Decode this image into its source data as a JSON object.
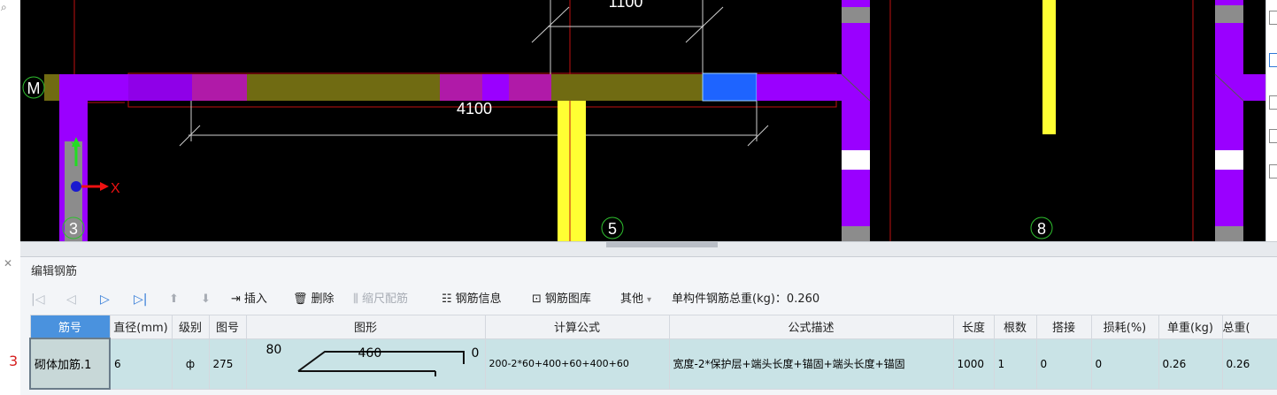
{
  "canvas": {
    "axis_labels": {
      "m": "M",
      "three": "3",
      "five": "5",
      "eight": "8"
    },
    "dimensions": {
      "main": "4100",
      "upper": "1100"
    },
    "coord_axes": {
      "x": "X",
      "y": "Y"
    },
    "colors": {
      "background": "#000000",
      "purple": "#9a00ff",
      "magenta": "#b01aa8",
      "olive": "#706b12",
      "yellow": "#ffff33",
      "blue": "#1e64ff"
    }
  },
  "panel": {
    "title": "编辑钢筋",
    "toolbar": {
      "first_icon": "first-record-icon",
      "prev_icon": "prev-record-icon",
      "next_icon": "next-record-icon",
      "last_icon": "last-record-icon",
      "up_icon": "move-up-icon",
      "down_icon": "move-down-icon",
      "insert": "插入",
      "delete": "删除",
      "scale_rebar": "缩尺配筋",
      "rebar_info": "钢筋信息",
      "rebar_library": "钢筋图库",
      "other": "其他",
      "total_weight": "单构件钢筋总重(kg)：0.260"
    },
    "table": {
      "columns": [
        "筋号",
        "直径(mm)",
        "级别",
        "图号",
        "图形",
        "计算公式",
        "公式描述",
        "长度",
        "根数",
        "搭接",
        "损耗(%)",
        "单重(kg)",
        "总重("
      ],
      "rows": [
        {
          "row_number": "3",
          "bar_no": "砌体加筋.1",
          "diameter": "6",
          "grade": "ф",
          "shape_no": "275",
          "shape": {
            "left": "80",
            "middle": "460",
            "right": "0"
          },
          "formula": "200-2*60+400+60+400+60",
          "formula_desc": "宽度-2*保护层+端头长度+锚固+端头长度+锚固",
          "length": "1000",
          "count": "1",
          "lap": "0",
          "loss": "0",
          "unit_weight": "0.26",
          "total_weight": "0.26"
        }
      ]
    }
  },
  "side": {
    "close_icon": "close-icon",
    "search_icon": "search-icon"
  }
}
